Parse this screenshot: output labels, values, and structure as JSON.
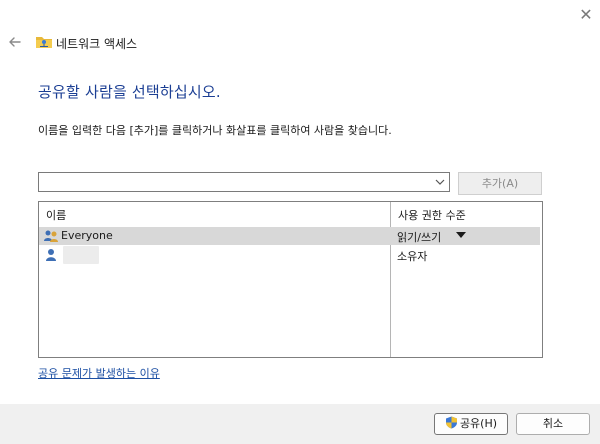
{
  "window": {
    "title": "네트워크 액세스",
    "close_label": "✕"
  },
  "heading": "공유할 사람을 선택하십시오.",
  "instruction": "이름을 입력한 다음 [추가]를 클릭하거나 화살표를 클릭하여 사람을 찾습니다.",
  "name_input": {
    "value": "",
    "placeholder": ""
  },
  "add_button": "추가(A)",
  "list": {
    "columns": [
      "이름",
      "사용 권한 수준"
    ],
    "rows": [
      {
        "name": "Everyone",
        "permission": "읽기/쓰기",
        "selected": true,
        "icon": "group-users-icon"
      },
      {
        "name": "",
        "permission": "소유자",
        "selected": false,
        "icon": "user-icon"
      }
    ]
  },
  "help_link": "공유 문제가 발생하는 이유",
  "buttons": {
    "share": "공유(H)",
    "cancel": "취소"
  },
  "colors": {
    "heading": "#1c3f94",
    "link": "#1c4fa3",
    "selection": "#d8d8d8",
    "footer": "#f0f0f0"
  }
}
